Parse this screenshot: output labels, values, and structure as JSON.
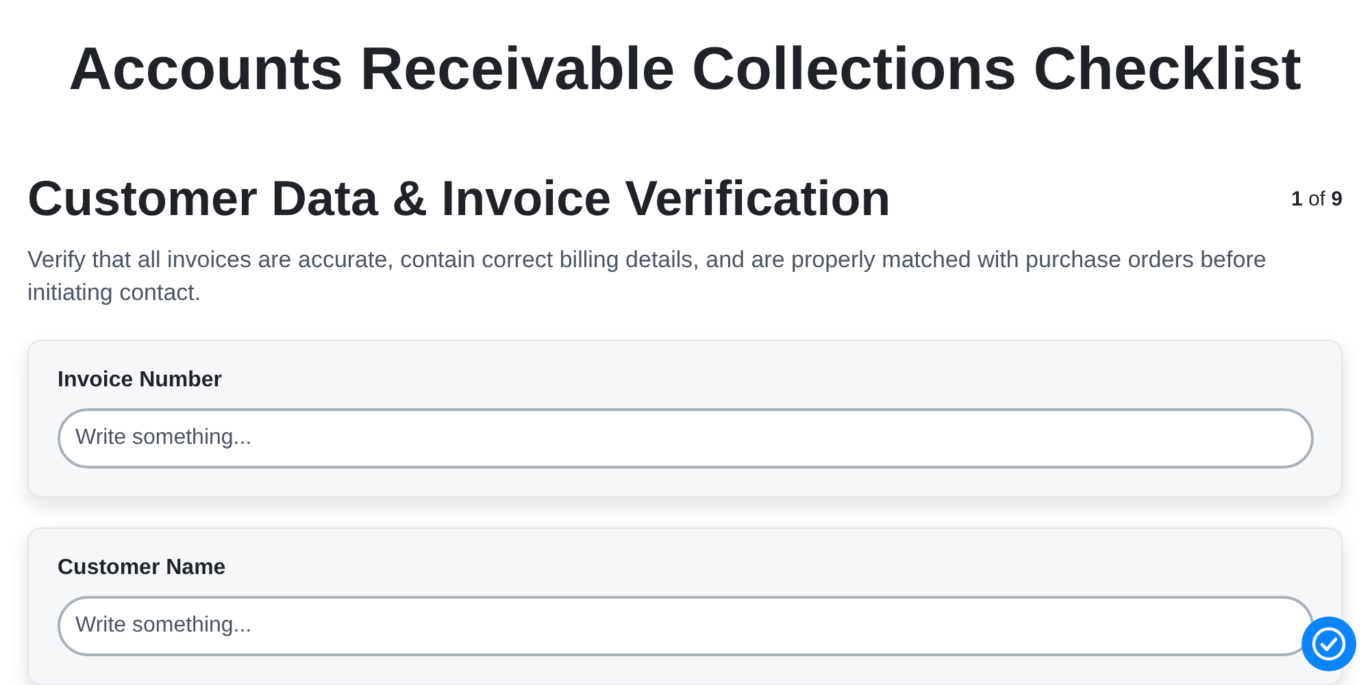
{
  "title": "Accounts Receivable Collections Checklist",
  "section": {
    "heading": "Customer Data & Invoice Verification",
    "progress": "**1** of **9**",
    "description": "Verify that all invoices are accurate, contain correct billing details, and are properly matched with purchase orders before initiating contact."
  },
  "fields": [
    {
      "label": "Invoice Number",
      "placeholder": "Write something..."
    },
    {
      "label": "Customer Name",
      "placeholder": "Write something..."
    }
  ]
}
